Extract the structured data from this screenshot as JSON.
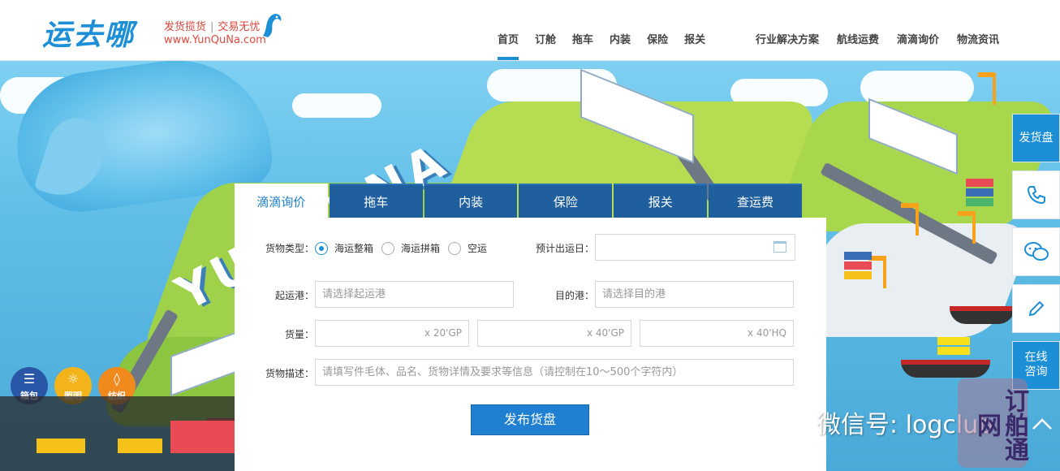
{
  "logo": {
    "mark": "运去哪",
    "slogan_left": "发货揽货",
    "slogan_sep": "|",
    "slogan_right": "交易无忧",
    "url": "www.YunQuNa.com"
  },
  "nav": {
    "left": [
      "首页",
      "订舱",
      "拖车",
      "内装",
      "保险",
      "报关"
    ],
    "right": [
      "行业解决方案",
      "航线运费",
      "滴滴询价",
      "物流资讯"
    ],
    "active": "首页"
  },
  "hero": {
    "big_text": "YUNQUNA",
    "categories": [
      {
        "label": "箱包",
        "color": "#2a56a8",
        "icon": "bag-icon"
      },
      {
        "label": "照明",
        "color": "#f2b31b",
        "icon": "bulb-icon"
      },
      {
        "label": "纺织",
        "color": "#f08a1d",
        "icon": "tag-icon"
      }
    ],
    "slider_next": "›"
  },
  "float_bar": {
    "ship": "发货盘",
    "phone_icon": "phone-icon",
    "chat_icon": "wechat-icon",
    "edit_icon": "pencil-icon",
    "online": "在线咨询"
  },
  "form": {
    "tabs": [
      "滴滴询价",
      "拖车",
      "内装",
      "保险",
      "报关",
      "查运费"
    ],
    "active_tab": "滴滴询价",
    "cargo_type_label": "货物类型：",
    "cargo_types": [
      "海运整箱",
      "海运拼箱",
      "空运"
    ],
    "cargo_type_selected": "海运整箱",
    "ship_date_label": "预计出运日：",
    "ship_date_value": "",
    "origin_label": "起运港：",
    "origin_placeholder": "请选择起运港",
    "dest_label": "目的港：",
    "dest_placeholder": "请选择目的港",
    "volume_label": "货量：",
    "volume_units": [
      "x 20'GP",
      "x 40'GP",
      "x 40'HQ"
    ],
    "desc_label": "货物描述：",
    "desc_placeholder": "请填写件毛体、品名、货物详情及要求等信息（请控制在10～500个字符内）",
    "submit": "发布货盘"
  },
  "watermark": {
    "text": "微信号: logclub",
    "seal": "订舶通网"
  },
  "colors": {
    "brand": "#1c8fd6",
    "tab_bg": "#1f5f9e",
    "slogan_red": "#d9453c",
    "submit": "#1f7fd0"
  }
}
